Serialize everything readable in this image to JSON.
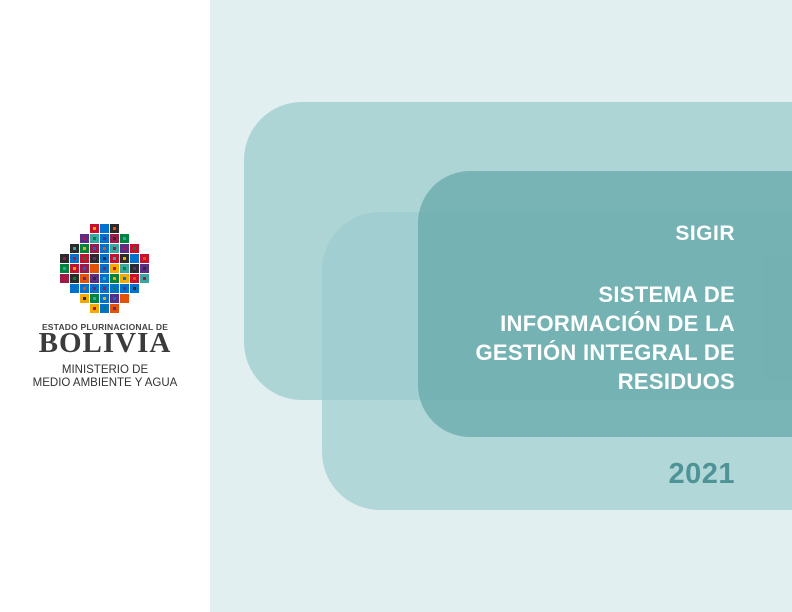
{
  "logo": {
    "icon": "bolivia-wiphala-emblem-icon",
    "state_label": "ESTADO PLURINACIONAL DE",
    "country": "BOLIVIA",
    "ministry_line1": "MINISTERIO DE",
    "ministry_line2": "MEDIO AMBIENTE Y AGUA"
  },
  "cover": {
    "acronym": "SIGIR",
    "title_line1": "SISTEMA DE",
    "title_line2": "INFORMACIÓN DE LA",
    "title_line3": "GESTIÓN INTEGRAL DE",
    "title_line4": "RESIDUOS",
    "year": "2021"
  },
  "colors": {
    "background": "#e1eff0",
    "shape_light": "#9bccce",
    "shape_dark": "#5ea3a5",
    "year_text": "#4e9497"
  }
}
